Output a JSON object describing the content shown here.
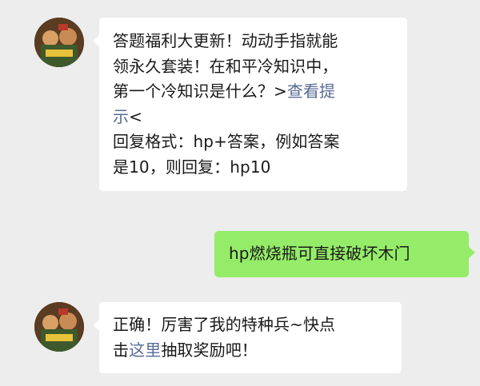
{
  "colors": {
    "background": "#ededed",
    "incoming_bubble": "#ffffff",
    "outgoing_bubble": "#95ec69",
    "link": "#576b95",
    "text": "#191919"
  },
  "messages": [
    {
      "direction": "incoming",
      "sender_avatar": "game-character-avatar",
      "lines": [
        {
          "text": "答题福利大更新！动动手指就能"
        },
        {
          "text": "领永久套装！在和平冷知识中，"
        },
        {
          "pre": "第一个冷知识是什么？>",
          "link": "查看提"
        },
        {
          "link": "示",
          "post": "<"
        },
        {
          "text": "回复格式：hp+答案，例如答案"
        },
        {
          "text": "是10，则回复：hp10"
        }
      ]
    },
    {
      "direction": "outgoing",
      "text": "hp燃烧瓶可直接破坏木门"
    },
    {
      "direction": "incoming",
      "sender_avatar": "game-character-avatar",
      "lines": [
        {
          "text": "正确！厉害了我的特种兵~快点"
        },
        {
          "pre": "击",
          "link": "这里",
          "post": "抽取奖励吧！"
        }
      ]
    }
  ]
}
